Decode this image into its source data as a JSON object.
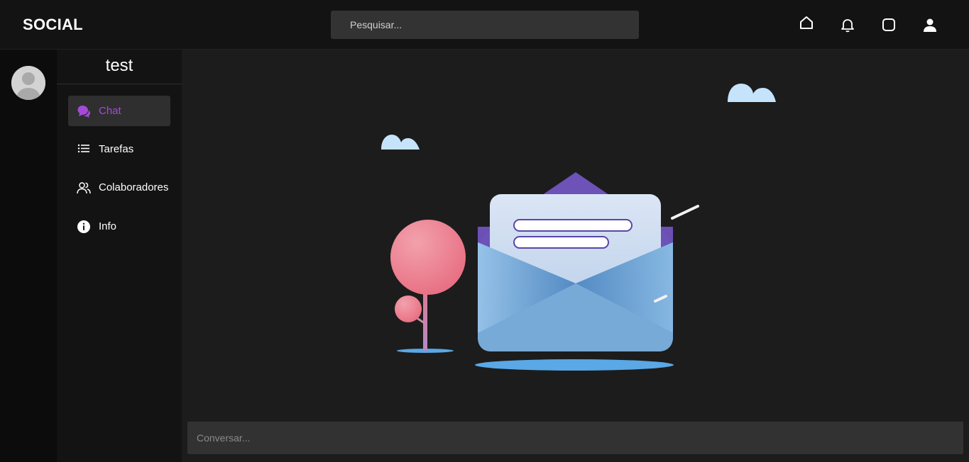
{
  "header": {
    "logo": "SOCIAL",
    "search_placeholder": "Pesquisar...",
    "icons": [
      "home-icon",
      "bell-icon",
      "square-icon",
      "user-icon"
    ]
  },
  "rail": {
    "avatar": "default-avatar"
  },
  "panel": {
    "title": "test",
    "items": [
      {
        "label": "Chat",
        "icon": "chat-bubble-icon",
        "active": true
      },
      {
        "label": "Tarefas",
        "icon": "list-icon",
        "active": false
      },
      {
        "label": "Colaboradores",
        "icon": "users-icon",
        "active": false
      },
      {
        "label": "Info",
        "icon": "info-icon",
        "active": false
      }
    ]
  },
  "main": {
    "illustration": "empty-inbox-envelope",
    "chat_placeholder": "Conversar..."
  },
  "colors": {
    "accent": "#a44ad6",
    "topbar": "#131313",
    "rail": "#0c0c0c",
    "panel": "#131313",
    "main": "#1c1c1c",
    "input": "#323232"
  }
}
